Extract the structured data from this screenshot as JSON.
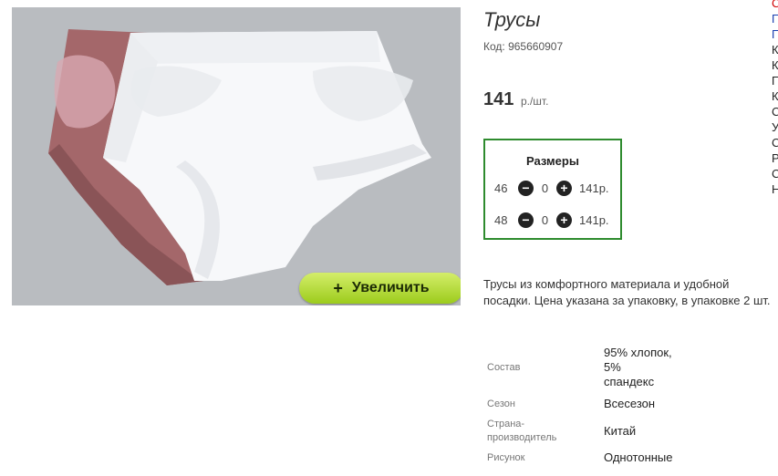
{
  "product": {
    "title": "Трусы",
    "code": "Код: 965660907",
    "price": "141",
    "price_unit": "р./шт.",
    "zoom_label": "Увеличить",
    "description": "Трусы из комфортного материала и удобной посадки. Цена указана за упаковку, в упаковке 2 шт."
  },
  "sizes": {
    "title": "Размеры",
    "rows": [
      {
        "size": "46",
        "qty": "0",
        "price": "141р."
      },
      {
        "size": "48",
        "qty": "0",
        "price": "141р."
      }
    ]
  },
  "attributes": [
    {
      "key": "Состав",
      "value_lines": [
        "95% хлопок,",
        "5%",
        "спандекс"
      ]
    },
    {
      "key": "Сезон",
      "value_lines": [
        "Всесезон"
      ]
    },
    {
      "key": "Страна-производитель",
      "value_lines": [
        "Китай"
      ]
    },
    {
      "key": "Рисунок",
      "value_lines": [
        "Однотонные"
      ]
    }
  ],
  "side_links": [
    "С",
    "П",
    "П",
    "К",
    "К",
    "П",
    "К",
    "С",
    "У",
    "С",
    "Р",
    "С",
    "Н"
  ],
  "colors": {
    "sizes_border": "#2e8b2e",
    "zoom_button": "#b8dd3c",
    "side_link_first": "#d00000",
    "side_link_blue": "#1a3fb0"
  }
}
